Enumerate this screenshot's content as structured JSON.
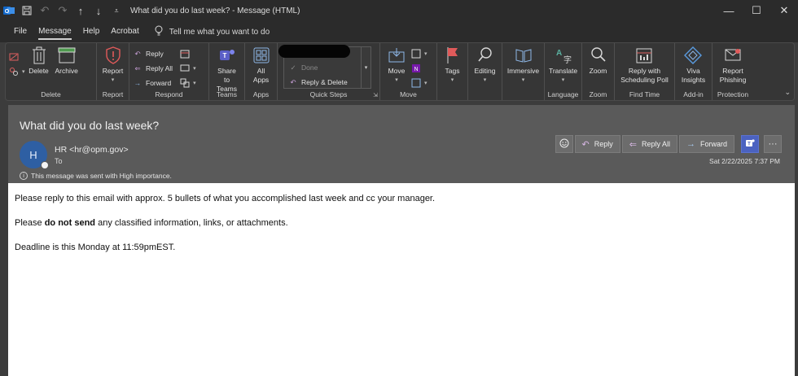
{
  "titlebar": {
    "title": "What did you do last week?  -  Message (HTML)"
  },
  "menu": {
    "items": [
      "File",
      "Message",
      "Help",
      "Acrobat"
    ],
    "active": "Message",
    "tell_me": "Tell me what you want to do"
  },
  "ribbon": {
    "delete_group": {
      "label": "Delete",
      "delete": "Delete",
      "archive": "Archive"
    },
    "report_group": {
      "label": "Report",
      "report": "Report"
    },
    "respond_group": {
      "label": "Respond",
      "reply": "Reply",
      "reply_all": "Reply All",
      "forward": "Forward"
    },
    "teams_group": {
      "label": "Teams",
      "share_line1": "Share to",
      "share_line2": "Teams"
    },
    "apps_group": {
      "label": "Apps",
      "all_line1": "All",
      "all_line2": "Apps"
    },
    "quicksteps_group": {
      "label": "Quick Steps",
      "done": "Done",
      "reply_delete": "Reply & Delete"
    },
    "move_group": {
      "label": "Move",
      "move": "Move"
    },
    "tags": {
      "label": "Tags"
    },
    "editing": {
      "label": "Editing"
    },
    "immersive": {
      "label": "Immersive"
    },
    "language_group": {
      "label": "Language",
      "translate": "Translate"
    },
    "zoom_group": {
      "label": "Zoom",
      "zoom": "Zoom"
    },
    "findtime_group": {
      "label": "Find Time",
      "line1": "Reply with",
      "line2": "Scheduling Poll"
    },
    "addin_group": {
      "label": "Add-in",
      "line1": "Viva",
      "line2": "Insights"
    },
    "protection_group": {
      "label": "Protection",
      "line1": "Report",
      "line2": "Phishing"
    }
  },
  "message": {
    "subject": "What did you do last week?",
    "avatar_initial": "H",
    "sender": "HR <hr@opm.gov>",
    "to_label": "To",
    "importance": "This message was sent with High importance.",
    "timestamp": "Sat 2/22/2025 7:37 PM",
    "actions": {
      "reply": "Reply",
      "reply_all": "Reply All",
      "forward": "Forward"
    },
    "body": {
      "line1": "Please reply to this email with approx. 5 bullets of what you accomplished last week and cc your manager.",
      "line2_pre": "Please ",
      "line2_bold": "do not send",
      "line2_post": " any classified information, links, or attachments.",
      "line3": "Deadline is this Monday at 11:59pmEST."
    }
  },
  "colors": {
    "avatar": "#2e5fa3",
    "teams": "#4b62c0",
    "report_red": "#e05a5a"
  }
}
